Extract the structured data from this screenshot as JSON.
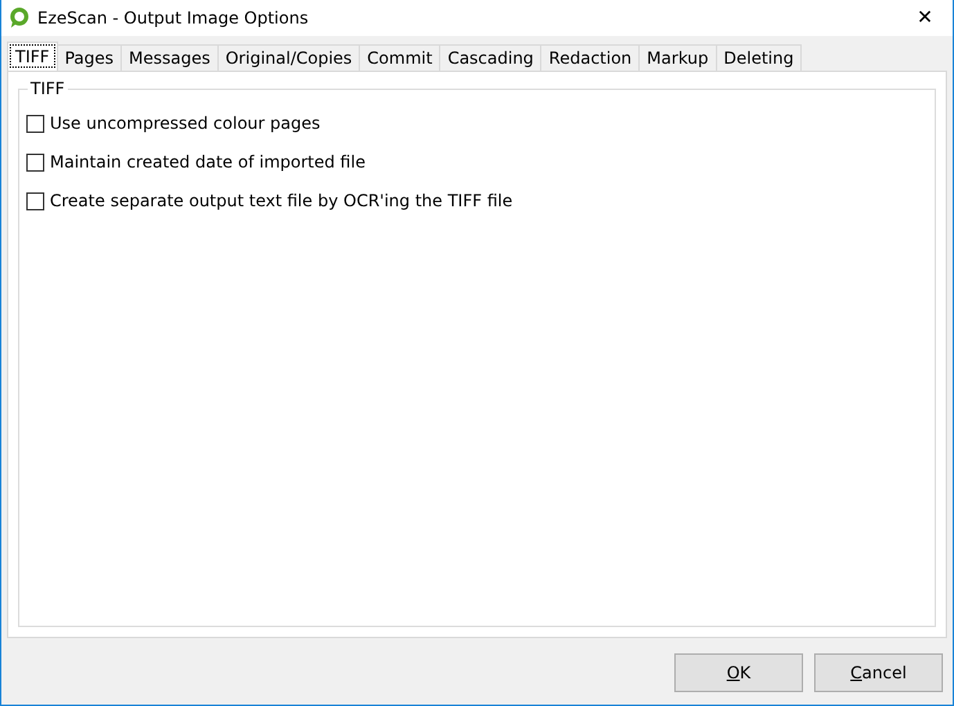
{
  "window": {
    "title": "EzeScan - Output Image Options",
    "close": "✕"
  },
  "tabs": [
    {
      "label": "TIFF",
      "selected": true
    },
    {
      "label": "Pages",
      "selected": false
    },
    {
      "label": "Messages",
      "selected": false
    },
    {
      "label": "Original/Copies",
      "selected": false
    },
    {
      "label": "Commit",
      "selected": false
    },
    {
      "label": "Cascading",
      "selected": false
    },
    {
      "label": "Redaction",
      "selected": false
    },
    {
      "label": "Markup",
      "selected": false
    },
    {
      "label": "Deleting",
      "selected": false
    }
  ],
  "group": {
    "title": "TIFF",
    "options": [
      {
        "label": "Use uncompressed colour pages",
        "checked": false
      },
      {
        "label": "Maintain created date of imported file",
        "checked": false
      },
      {
        "label": "Create separate output text file by OCR'ing the TIFF file",
        "checked": false
      }
    ]
  },
  "buttons": [
    "OK",
    "Cancel"
  ]
}
